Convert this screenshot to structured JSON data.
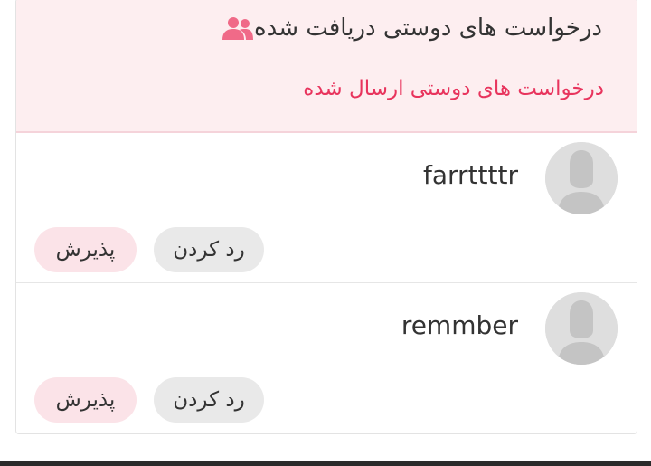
{
  "tabs": {
    "received_label": "درخواست های دوستی دریافت شده",
    "sent_label": "درخواست های دوستی ارسال شده",
    "accent_color": "#e8345d"
  },
  "requests": [
    {
      "username": "farrttttr",
      "reject_label": "رد کردن",
      "accept_label": "پذیرش"
    },
    {
      "username": "remmber",
      "reject_label": "رد کردن",
      "accept_label": "پذیرش"
    }
  ],
  "icons": {
    "tab_icon": "users-icon",
    "avatar_icon": "default-avatar-icon"
  }
}
